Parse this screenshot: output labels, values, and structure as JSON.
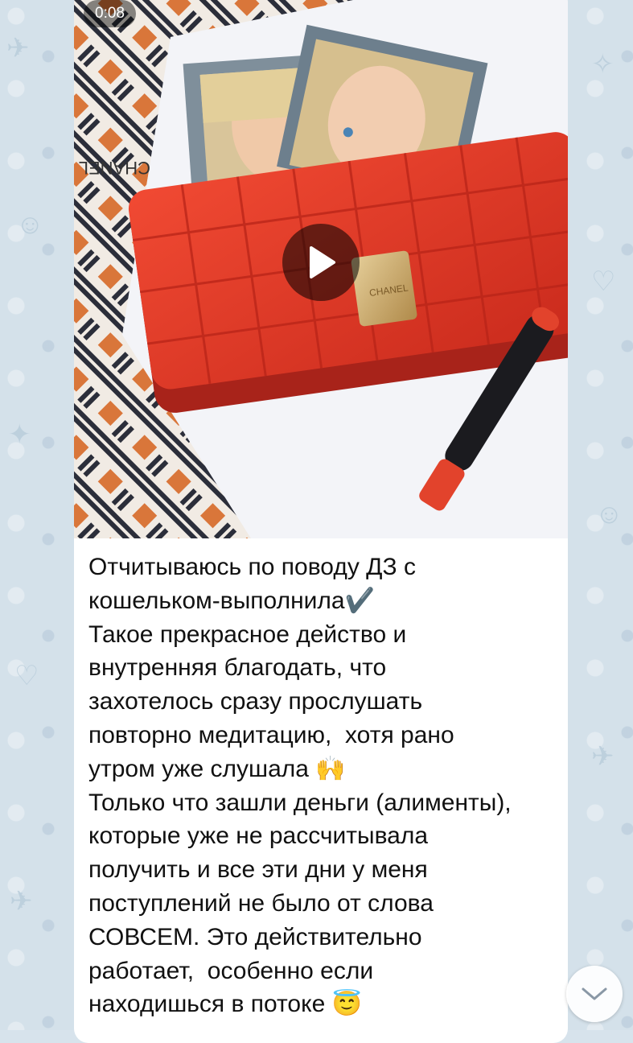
{
  "video": {
    "duration": "0:08",
    "icons": {
      "play": "play-icon"
    }
  },
  "message": {
    "text": "Отчитываюсь по поводу ДЗ с\nкошельком-выполнила✔️\nТакое прекрасное действо и\nвнутренняя благодать, что\nзахотелось сразу прослушать\nповторно медитацию,  хотя рано\nутром уже слушала 🙌\nТолько что зашли деньги (алименты),\nкоторые уже не рассчитывала\nполучить и все эти дни у меня\nпоступлений не было от слова\nСОВСЕМ. Это действительно\nработает,  особенно если\nнаходишься в потоке 😇"
  },
  "controls": {
    "scroll_down_icon": "chevron-down-icon"
  },
  "colors": {
    "wallpaper": "#d4e1ea",
    "wallet": "#e8392a",
    "accent_orange": "#d9763a",
    "bubble": "#ffffff"
  }
}
